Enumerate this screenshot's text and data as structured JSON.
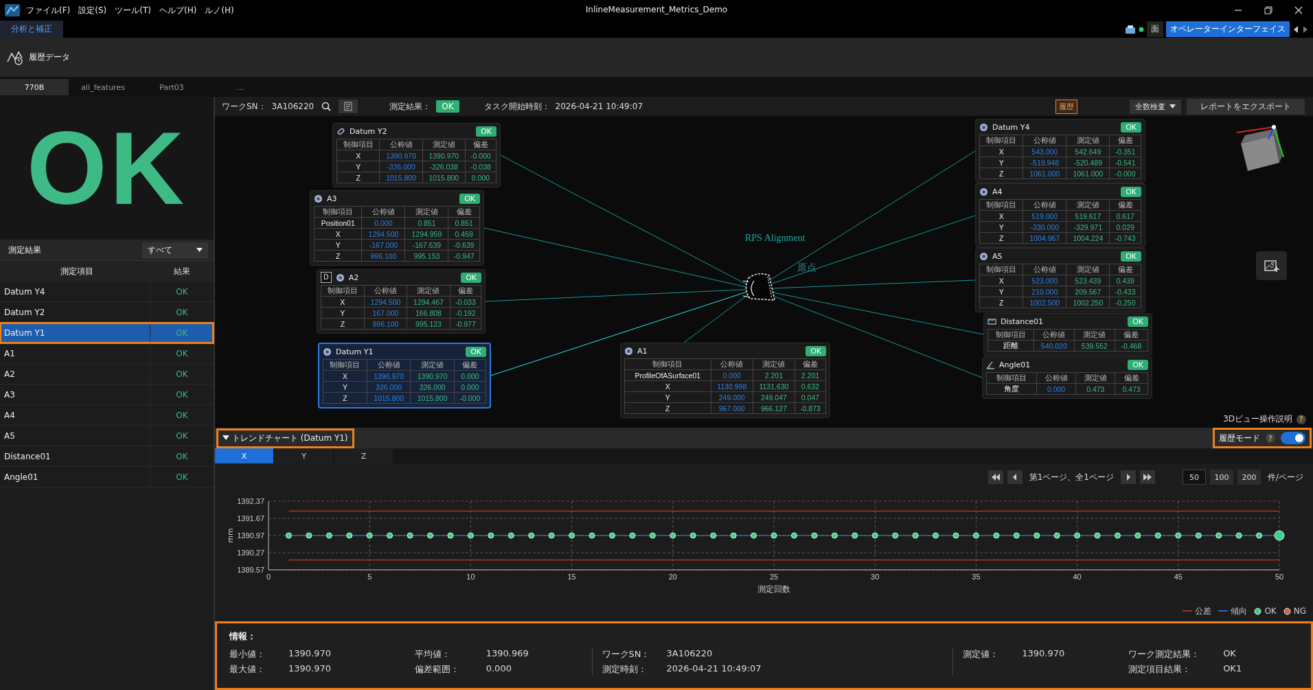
{
  "window": {
    "title": "InlineMeasurement_Metrics_Demo"
  },
  "menu": [
    "ファイル(F)",
    "設定(S)",
    "ツール(T)",
    "ヘルプ(H)",
    "ルノ(H)"
  ],
  "mode_tabs": [
    {
      "label": "分析と補正",
      "selected": true
    }
  ],
  "view_tabs": [
    {
      "label": "面",
      "selected": false
    },
    {
      "label": "オペレーターインターフェイス",
      "selected": true
    }
  ],
  "toolbar": {
    "label": "履歴データ"
  },
  "part_tabs": [
    {
      "label": "770B",
      "selected": true
    },
    {
      "label": "all_features",
      "selected": false
    },
    {
      "label": "Part03",
      "selected": false
    },
    {
      "label": "...",
      "selected": false
    }
  ],
  "result_panel": {
    "result": "OK",
    "filter_label": "測定結果",
    "filter_value": "すべて",
    "columns": [
      "測定項目",
      "結果"
    ],
    "rows": [
      {
        "item": "Datum Y4",
        "result": "OK",
        "selected": false,
        "highlighted": false
      },
      {
        "item": "Datum Y2",
        "result": "OK",
        "selected": false,
        "highlighted": false
      },
      {
        "item": "Datum Y1",
        "result": "OK",
        "selected": true,
        "highlighted": true
      },
      {
        "item": "A1",
        "result": "OK",
        "selected": false,
        "highlighted": false
      },
      {
        "item": "A2",
        "result": "OK",
        "selected": false,
        "highlighted": false
      },
      {
        "item": "A3",
        "result": "OK",
        "selected": false,
        "highlighted": false
      },
      {
        "item": "A4",
        "result": "OK",
        "selected": false,
        "highlighted": false
      },
      {
        "item": "A5",
        "result": "OK",
        "selected": false,
        "highlighted": false
      },
      {
        "item": "Distance01",
        "result": "OK",
        "selected": false,
        "highlighted": false
      },
      {
        "item": "Angle01",
        "result": "OK",
        "selected": false,
        "highlighted": false
      }
    ]
  },
  "header_bar": {
    "sn_label": "ワークSN：",
    "sn": "3A106220",
    "result_label": "測定結果：",
    "result": "OK",
    "time_label": "タスク開始時刻：",
    "time": "2026-04-21 10:49:07",
    "history_button": "履歴",
    "inspection_dropdown": "全数検査",
    "export_button": "レポートをエクスポート"
  },
  "view3d": {
    "labels": [
      "RPS Alignment",
      "原点"
    ],
    "help": "3Dビュー操作説明",
    "help_icon": "?",
    "cards": [
      {
        "name": "Datum Y2",
        "kind": "cylinder",
        "status": "OK",
        "selected": false,
        "columns": [
          "制御項目",
          "公称値",
          "測定値",
          "偏差"
        ],
        "rows": [
          [
            "X",
            "1390.970",
            "1390.970",
            "-0.000"
          ],
          [
            "Y",
            "-326.000",
            "-326.038",
            "-0.038"
          ],
          [
            "Z",
            "1015.800",
            "1015.800",
            "0.000"
          ]
        ]
      },
      {
        "name": "A3",
        "kind": "point",
        "status": "OK",
        "selected": false,
        "columns": [
          "制御項目",
          "公称値",
          "測定値",
          "偏差"
        ],
        "rows": [
          [
            "Position01",
            "0.000",
            "0.851",
            "0.851"
          ],
          [
            "X",
            "1294.500",
            "1294.959",
            "0.459"
          ],
          [
            "Y",
            "-167.000",
            "-167.639",
            "-0.639"
          ],
          [
            "Z",
            "996.100",
            "995.153",
            "-0.947"
          ]
        ]
      },
      {
        "name": "A2",
        "kind": "point",
        "tag": "D",
        "status": "OK",
        "selected": false,
        "columns": [
          "制御項目",
          "公称値",
          "測定値",
          "偏差"
        ],
        "rows": [
          [
            "X",
            "1294.500",
            "1294.467",
            "-0.033"
          ],
          [
            "Y",
            "167.000",
            "166.808",
            "-0.192"
          ],
          [
            "Z",
            "996.100",
            "995.123",
            "-0.977"
          ]
        ]
      },
      {
        "name": "Datum Y1",
        "kind": "point",
        "status": "OK",
        "selected": true,
        "columns": [
          "制御項目",
          "公称値",
          "測定値",
          "偏差"
        ],
        "rows": [
          [
            "X",
            "1390.970",
            "1390.970",
            "0.000"
          ],
          [
            "Y",
            "326.000",
            "326.000",
            "0.000"
          ],
          [
            "Z",
            "1015.800",
            "1015.800",
            "-0.000"
          ]
        ]
      },
      {
        "name": "A1",
        "kind": "point",
        "status": "OK",
        "selected": false,
        "columns": [
          "制御項目",
          "公称値",
          "測定値",
          "偏差"
        ],
        "rows": [
          [
            "ProfileOfASurface01",
            "0.000",
            "2.201",
            "2.201"
          ],
          [
            "X",
            "1130.998",
            "1131.630",
            "0.632"
          ],
          [
            "Y",
            "249.000",
            "249.047",
            "0.047"
          ],
          [
            "Z",
            "967.000",
            "966.127",
            "-0.873"
          ]
        ]
      },
      {
        "name": "Datum Y4",
        "kind": "point",
        "status": "OK",
        "selected": false,
        "columns": [
          "制御項目",
          "公称値",
          "測定値",
          "偏差"
        ],
        "rows": [
          [
            "X",
            "543.000",
            "542.649",
            "-0.351"
          ],
          [
            "Y",
            "-519.948",
            "-520.489",
            "-0.541"
          ],
          [
            "Z",
            "1061.000",
            "1061.000",
            "-0.000"
          ]
        ]
      },
      {
        "name": "A4",
        "kind": "point",
        "status": "OK",
        "selected": false,
        "columns": [
          "制御項目",
          "公称値",
          "測定値",
          "偏差"
        ],
        "rows": [
          [
            "X",
            "519.000",
            "519.617",
            "0.617"
          ],
          [
            "Y",
            "-330.000",
            "-329.971",
            "0.029"
          ],
          [
            "Z",
            "1004.967",
            "1004.224",
            "-0.743"
          ]
        ]
      },
      {
        "name": "A5",
        "kind": "point",
        "status": "OK",
        "selected": false,
        "columns": [
          "制御項目",
          "公称値",
          "測定値",
          "偏差"
        ],
        "rows": [
          [
            "X",
            "523.000",
            "523.439",
            "0.439"
          ],
          [
            "Y",
            "210.000",
            "209.567",
            "-0.433"
          ],
          [
            "Z",
            "1002.500",
            "1002.250",
            "-0.250"
          ]
        ]
      },
      {
        "name": "Distance01",
        "kind": "distance",
        "status": "OK",
        "selected": false,
        "columns": [
          "制御項目",
          "公称値",
          "測定値",
          "偏差"
        ],
        "rows": [
          [
            "距離",
            "540.020",
            "539.552",
            "-0.468"
          ]
        ]
      },
      {
        "name": "Angle01",
        "kind": "angle",
        "status": "OK",
        "selected": false,
        "columns": [
          "制御項目",
          "公称値",
          "測定値",
          "偏差"
        ],
        "rows": [
          [
            "角度",
            "0.000",
            "0.473",
            "0.473"
          ]
        ]
      }
    ]
  },
  "trend": {
    "title": "トレンドチャート (Datum Y1)",
    "expanded": true,
    "highlighted": true,
    "history_mode": {
      "label": "履歴モード",
      "help_icon": "?",
      "on": true,
      "highlighted": true
    },
    "tabs": [
      {
        "label": "X",
        "selected": true
      },
      {
        "label": "Y",
        "selected": false
      },
      {
        "label": "Z",
        "selected": false
      }
    ],
    "pager": {
      "page_text": "第1ページ、全1ページ",
      "sizes": [
        {
          "label": "50",
          "selected": true
        },
        {
          "label": "100",
          "selected": false
        },
        {
          "label": "200",
          "selected": false
        }
      ],
      "unit": "件/ページ"
    },
    "chart_data": {
      "type": "line",
      "xlabel": "測定回数",
      "ylabel": "mm",
      "grid": true,
      "x": [
        1,
        2,
        3,
        4,
        5,
        6,
        7,
        8,
        9,
        10,
        11,
        12,
        13,
        14,
        15,
        16,
        17,
        18,
        19,
        20,
        21,
        22,
        23,
        24,
        25,
        26,
        27,
        28,
        29,
        30,
        31,
        32,
        33,
        34,
        35,
        36,
        37,
        38,
        39,
        40,
        41,
        42,
        43,
        44,
        45,
        46,
        47,
        48,
        49,
        50
      ],
      "series": [
        {
          "name": "公差",
          "color": "#c0392b",
          "values": [
            1391.97,
            1391.97,
            1391.97,
            1391.97,
            1391.97,
            1391.97,
            1391.97,
            1391.97,
            1391.97,
            1391.97,
            1391.97,
            1391.97,
            1391.97,
            1391.97,
            1391.97,
            1391.97,
            1391.97,
            1391.97,
            1391.97,
            1391.97,
            1391.97,
            1391.97,
            1391.97,
            1391.97,
            1391.97,
            1391.97,
            1391.97,
            1391.97,
            1391.97,
            1391.97,
            1391.97,
            1391.97,
            1391.97,
            1391.97,
            1391.97,
            1391.97,
            1391.97,
            1391.97,
            1391.97,
            1391.97,
            1391.97,
            1391.97,
            1391.97,
            1391.97,
            1391.97,
            1391.97,
            1391.97,
            1391.97,
            1391.97,
            1391.97
          ]
        },
        {
          "color": "#c0392b",
          "values": [
            1389.97,
            1389.97,
            1389.97,
            1389.97,
            1389.97,
            1389.97,
            1389.97,
            1389.97,
            1389.97,
            1389.97,
            1389.97,
            1389.97,
            1389.97,
            1389.97,
            1389.97,
            1389.97,
            1389.97,
            1389.97,
            1389.97,
            1389.97,
            1389.97,
            1389.97,
            1389.97,
            1389.97,
            1389.97,
            1389.97,
            1389.97,
            1389.97,
            1389.97,
            1389.97,
            1389.97,
            1389.97,
            1389.97,
            1389.97,
            1389.97,
            1389.97,
            1389.97,
            1389.97,
            1389.97,
            1389.97,
            1389.97,
            1389.97,
            1389.97,
            1389.97,
            1389.97,
            1389.97,
            1389.97,
            1389.97,
            1389.97,
            1389.97
          ]
        },
        {
          "name": "傾向",
          "color": "#3d7fc4",
          "marker": "circle",
          "values": [
            1390.97,
            1390.97,
            1390.97,
            1390.97,
            1390.97,
            1390.97,
            1390.97,
            1390.97,
            1390.97,
            1390.97,
            1390.97,
            1390.97,
            1390.97,
            1390.97,
            1390.97,
            1390.97,
            1390.97,
            1390.97,
            1390.97,
            1390.97,
            1390.97,
            1390.97,
            1390.97,
            1390.97,
            1390.97,
            1390.97,
            1390.97,
            1390.97,
            1390.97,
            1390.97,
            1390.97,
            1390.97,
            1390.97,
            1390.97,
            1390.97,
            1390.97,
            1390.97,
            1390.97,
            1390.97,
            1390.97,
            1390.97,
            1390.97,
            1390.97,
            1390.97,
            1390.97,
            1390.97,
            1390.97,
            1390.97,
            1390.97,
            1390.97
          ]
        }
      ],
      "xlim": [
        0,
        50
      ],
      "ylim": [
        1389.57,
        1392.37
      ],
      "xticks": [
        0,
        5,
        10,
        15,
        20,
        25,
        30,
        35,
        40,
        45,
        50
      ],
      "yticks": [
        1389.57,
        1390.27,
        1390.97,
        1391.67,
        1392.37
      ]
    },
    "legend": [
      {
        "label": "OK",
        "color": "#3ecf8e"
      },
      {
        "label": "NG",
        "color": "#e05a47"
      }
    ]
  },
  "info": {
    "title": "情報：",
    "highlighted": true,
    "groups": [
      [
        {
          "label": "最小値：",
          "value": "1390.970"
        },
        {
          "label": "最大値：",
          "value": "1390.970"
        }
      ],
      [
        {
          "label": "平均値：",
          "value": "1390.969"
        },
        {
          "label": "偏差範囲：",
          "value": "0.000"
        }
      ],
      [
        {
          "label": "ワークSN：",
          "value": "3A106220"
        },
        {
          "label": "測定時刻：",
          "value": "2026-04-21 10:49:07"
        }
      ],
      [
        {
          "label": "測定値：",
          "value": "1390.970"
        }
      ],
      [
        {
          "label": "ワーク測定結果：",
          "value": "OK"
        },
        {
          "label": "測定項目結果：",
          "value": "OK1"
        }
      ]
    ]
  }
}
